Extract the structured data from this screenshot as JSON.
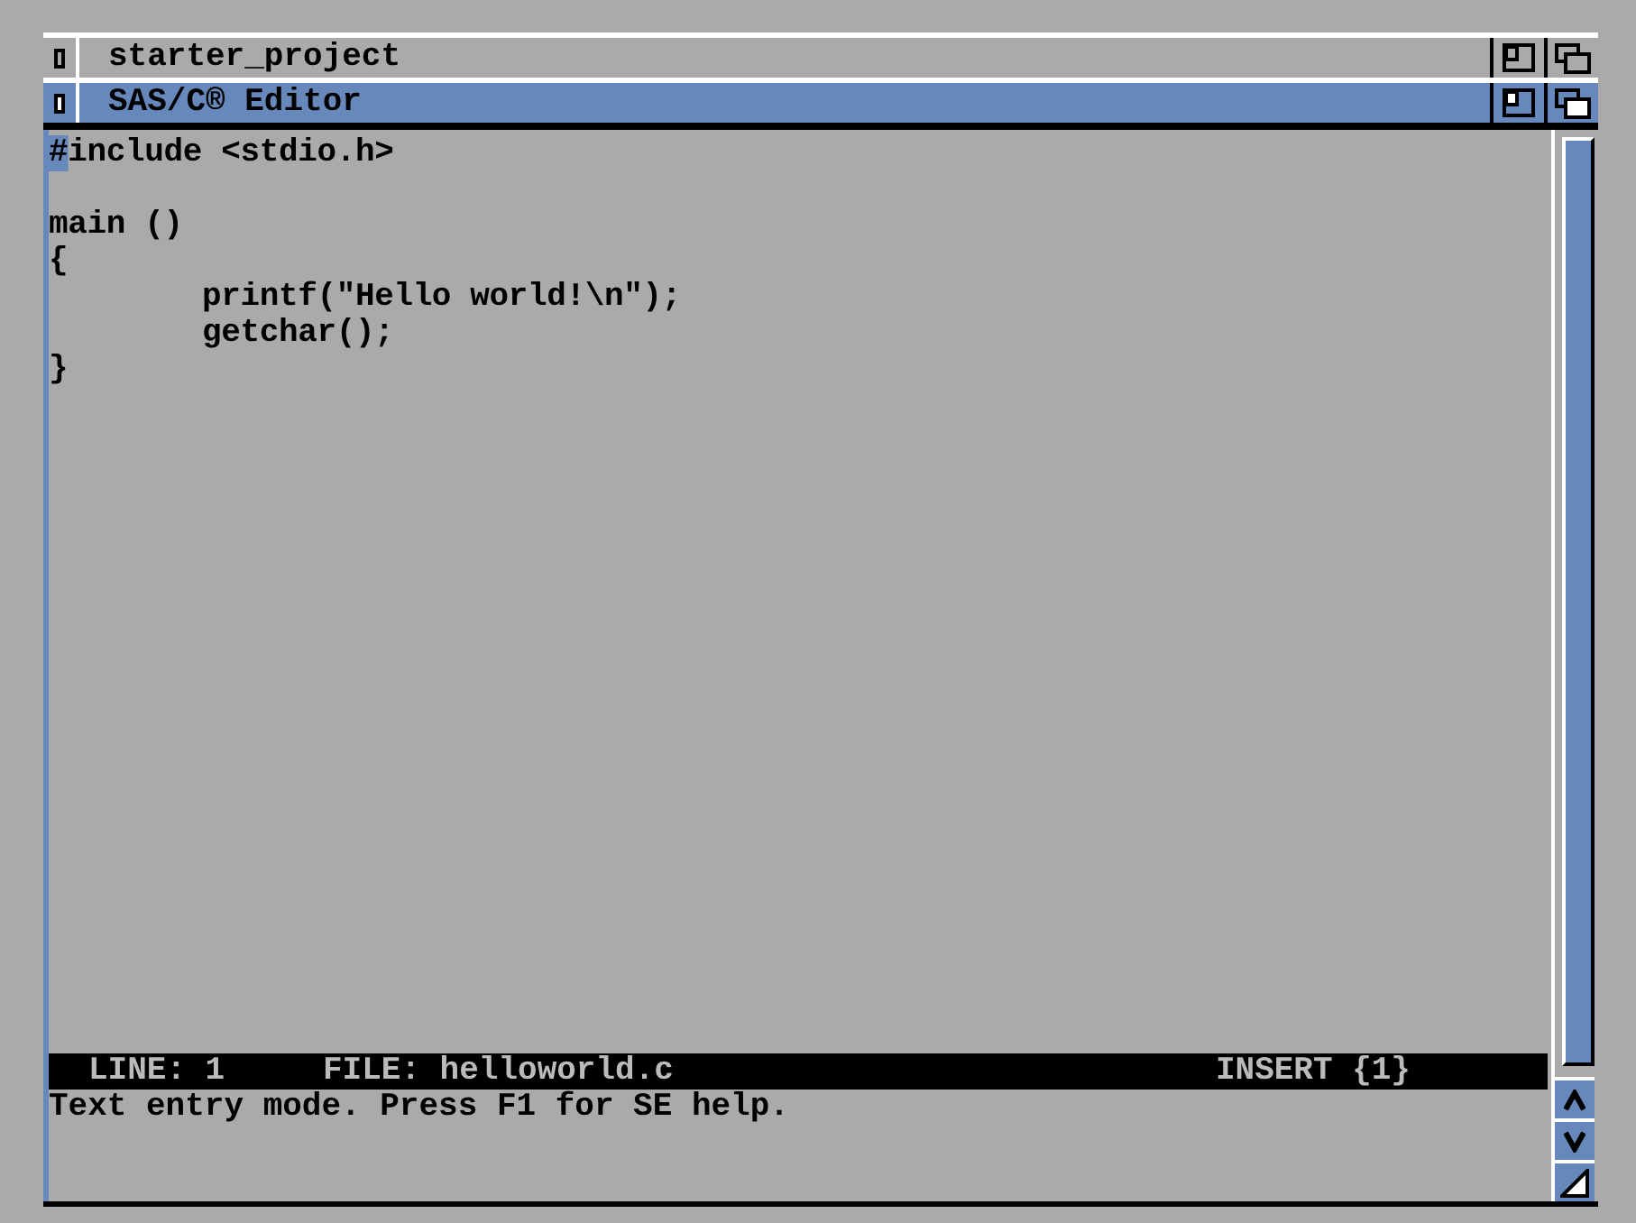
{
  "back_window": {
    "title": "starter_project"
  },
  "window": {
    "title": "SAS/C® Editor",
    "active": true
  },
  "code_lines": [
    {
      "kind": "code",
      "text": "#include <stdio.h>",
      "cursor": true
    },
    {
      "kind": "blank"
    },
    {
      "kind": "code",
      "text": "main ()",
      "cursor": false
    },
    {
      "kind": "code",
      "text": "{",
      "cursor": false
    },
    {
      "kind": "code",
      "text": "        printf(\"Hello world!\\n\");",
      "cursor": false
    },
    {
      "kind": "code",
      "text": "        getchar();",
      "cursor": false
    },
    {
      "kind": "code",
      "text": "}",
      "cursor": false
    }
  ],
  "status_bar": {
    "line": "LINE: 1",
    "file": "FILE: helloworld.c",
    "mode": "INSERT {1}"
  },
  "message": "Text entry mode. Press F1 for SE help."
}
